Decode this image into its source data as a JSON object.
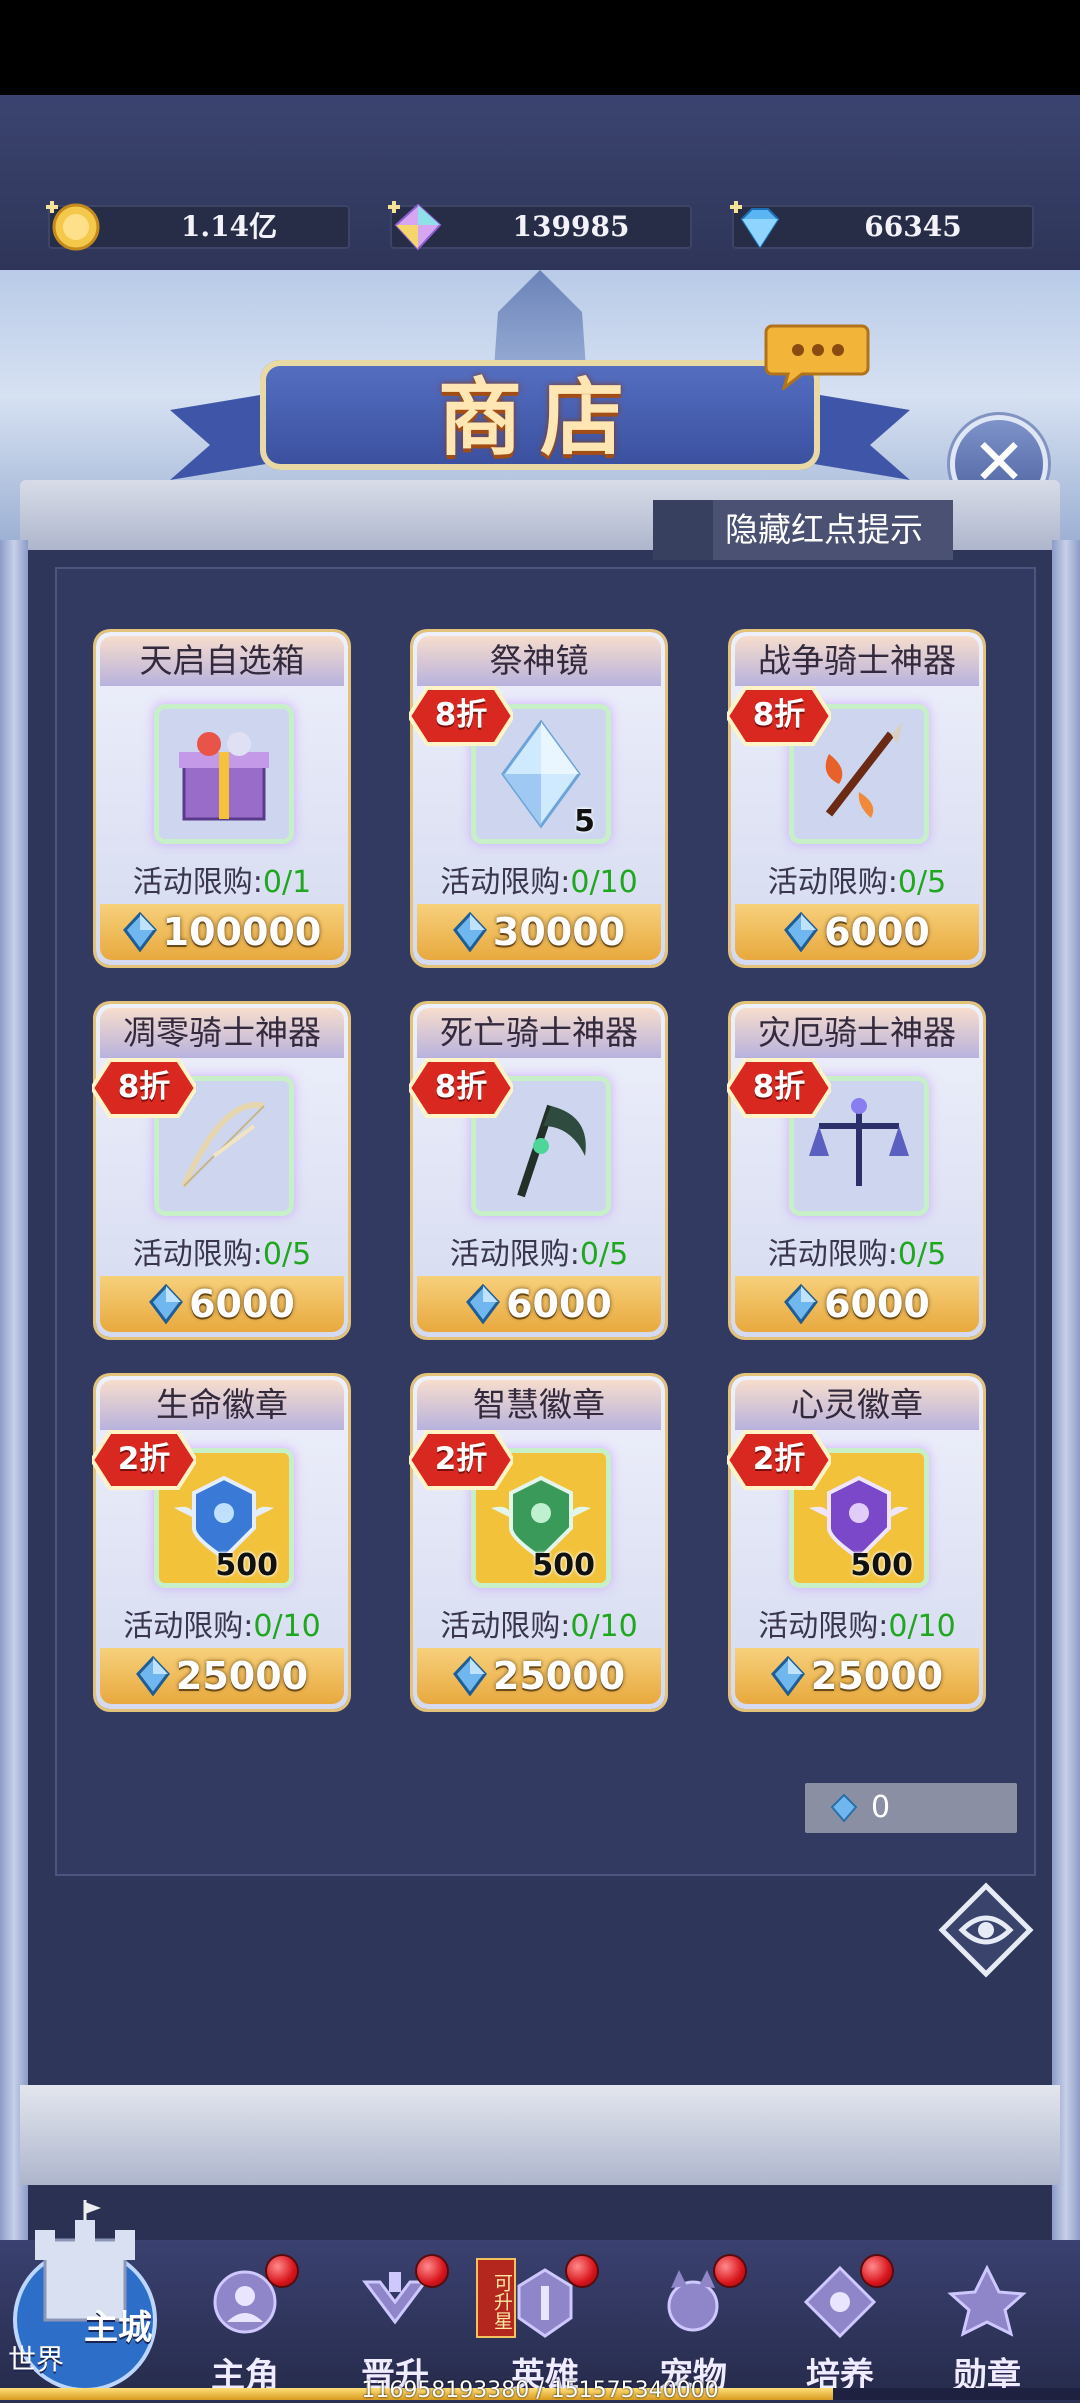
{
  "resources": [
    {
      "name": "gold-coin",
      "value": "1.14亿"
    },
    {
      "name": "rainbow-crystal",
      "value": "139985"
    },
    {
      "name": "blue-diamond",
      "value": "66345"
    }
  ],
  "header": {
    "title": "商店"
  },
  "hide_red_dot_label": "隐藏红点提示",
  "cards": [
    {
      "name": "天启自选箱",
      "discount": "",
      "qty": "",
      "limit_label": "活动限购:",
      "limit_value": "0/1",
      "price": "100000",
      "icon": "gift-box-icon"
    },
    {
      "name": "祭神镜",
      "discount": "8折",
      "qty": "5",
      "limit_label": "活动限购:",
      "limit_value": "0/10",
      "price": "30000",
      "icon": "crystal-icon"
    },
    {
      "name": "战争骑士神器",
      "discount": "8折",
      "qty": "",
      "limit_label": "活动限购:",
      "limit_value": "0/5",
      "price": "6000",
      "icon": "spear-icon"
    },
    {
      "name": "凋零骑士神器",
      "discount": "8折",
      "qty": "",
      "limit_label": "活动限购:",
      "limit_value": "0/5",
      "price": "6000",
      "icon": "bow-icon"
    },
    {
      "name": "死亡骑士神器",
      "discount": "8折",
      "qty": "",
      "limit_label": "活动限购:",
      "limit_value": "0/5",
      "price": "6000",
      "icon": "scythe-icon"
    },
    {
      "name": "灾厄骑士神器",
      "discount": "8折",
      "qty": "",
      "limit_label": "活动限购:",
      "limit_value": "0/5",
      "price": "6000",
      "icon": "scales-icon"
    },
    {
      "name": "生命徽章",
      "discount": "2折",
      "qty": "500",
      "limit_label": "活动限购:",
      "limit_value": "0/10",
      "price": "25000",
      "icon": "blue-badge-icon"
    },
    {
      "name": "智慧徽章",
      "discount": "2折",
      "qty": "500",
      "limit_label": "活动限购:",
      "limit_value": "0/10",
      "price": "25000",
      "icon": "green-badge-icon"
    },
    {
      "name": "心灵徽章",
      "discount": "2折",
      "qty": "500",
      "limit_label": "活动限购:",
      "limit_value": "0/10",
      "price": "25000",
      "icon": "purple-badge-icon"
    }
  ],
  "wallet_amount": "0",
  "nav": {
    "castle_label_1": "主城",
    "castle_label_2": "世界",
    "upstar_tag": "可升星",
    "items": [
      {
        "label": "主角",
        "dot": true
      },
      {
        "label": "晋升",
        "dot": true
      },
      {
        "label": "英雄",
        "dot": true
      },
      {
        "label": "宠物",
        "dot": true
      },
      {
        "label": "培养",
        "dot": true
      },
      {
        "label": "勋章",
        "dot": false
      }
    ]
  },
  "exp": {
    "text": "116958193380 / 151575340000",
    "fraction": 0.7716
  },
  "colors": {
    "accent_gold": "#e8a93e",
    "limit_green": "#1fa71f",
    "discount_red": "#d8281f",
    "panel": "#2e365a"
  }
}
